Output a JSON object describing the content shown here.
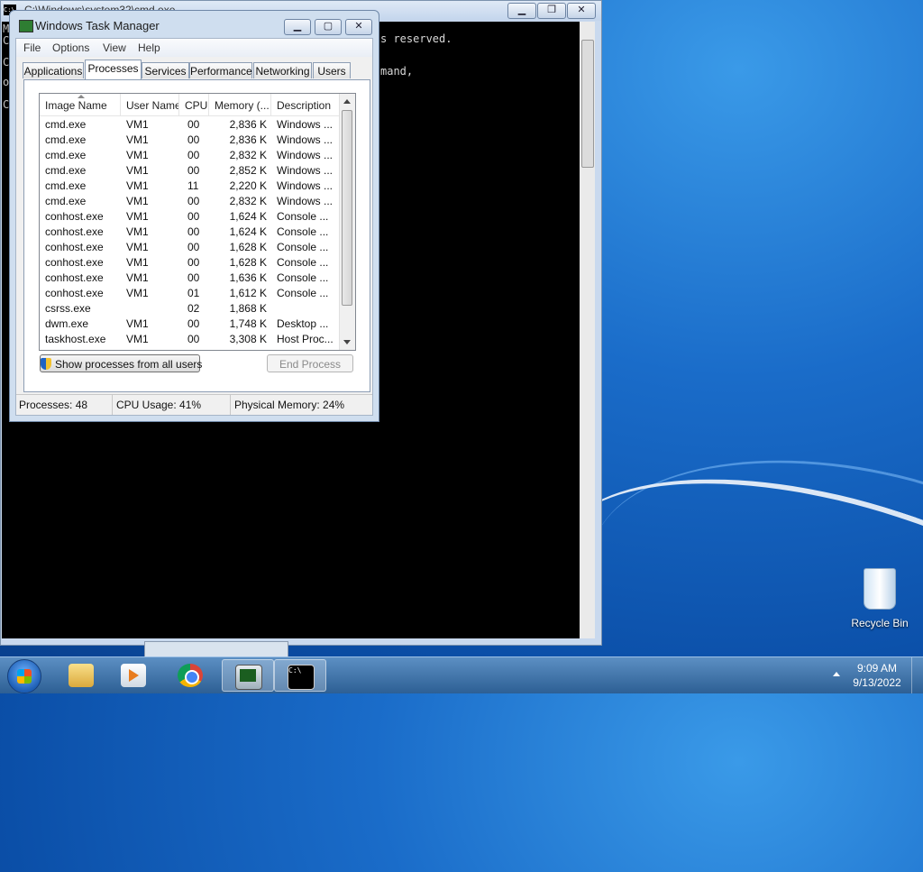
{
  "cmd": {
    "title": "C:\\Windows\\system32\\cmd.exe",
    "icon_label": "C:\\",
    "lines": [
      "M",
      "C",
      "",
      "C",
      "o",
      "",
      "C"
    ],
    "right_fragments": [
      "s reserved.",
      "",
      "mand,"
    ]
  },
  "taskmgr": {
    "title": "Windows Task Manager",
    "menu": [
      "File",
      "Options",
      "View",
      "Help"
    ],
    "tabs": [
      "Applications",
      "Processes",
      "Services",
      "Performance",
      "Networking",
      "Users"
    ],
    "active_tab": "Processes",
    "columns": [
      "Image Name",
      "User Name",
      "CPU",
      "Memory (...",
      "Description"
    ],
    "rows": [
      {
        "image": "cmd.exe",
        "user": "VM1",
        "cpu": "00",
        "mem": "2,836 K",
        "desc": "Windows ..."
      },
      {
        "image": "cmd.exe",
        "user": "VM1",
        "cpu": "00",
        "mem": "2,836 K",
        "desc": "Windows ..."
      },
      {
        "image": "cmd.exe",
        "user": "VM1",
        "cpu": "00",
        "mem": "2,832 K",
        "desc": "Windows ..."
      },
      {
        "image": "cmd.exe",
        "user": "VM1",
        "cpu": "00",
        "mem": "2,852 K",
        "desc": "Windows ..."
      },
      {
        "image": "cmd.exe",
        "user": "VM1",
        "cpu": "11",
        "mem": "2,220 K",
        "desc": "Windows ..."
      },
      {
        "image": "cmd.exe",
        "user": "VM1",
        "cpu": "00",
        "mem": "2,832 K",
        "desc": "Windows ..."
      },
      {
        "image": "conhost.exe",
        "user": "VM1",
        "cpu": "00",
        "mem": "1,624 K",
        "desc": "Console ..."
      },
      {
        "image": "conhost.exe",
        "user": "VM1",
        "cpu": "00",
        "mem": "1,624 K",
        "desc": "Console ..."
      },
      {
        "image": "conhost.exe",
        "user": "VM1",
        "cpu": "00",
        "mem": "1,628 K",
        "desc": "Console ..."
      },
      {
        "image": "conhost.exe",
        "user": "VM1",
        "cpu": "00",
        "mem": "1,628 K",
        "desc": "Console ..."
      },
      {
        "image": "conhost.exe",
        "user": "VM1",
        "cpu": "00",
        "mem": "1,636 K",
        "desc": "Console ..."
      },
      {
        "image": "conhost.exe",
        "user": "VM1",
        "cpu": "01",
        "mem": "1,612 K",
        "desc": "Console ..."
      },
      {
        "image": "csrss.exe",
        "user": "",
        "cpu": "02",
        "mem": "1,868 K",
        "desc": ""
      },
      {
        "image": "dwm.exe",
        "user": "VM1",
        "cpu": "00",
        "mem": "1,748 K",
        "desc": "Desktop ..."
      },
      {
        "image": "taskhost.exe",
        "user": "VM1",
        "cpu": "00",
        "mem": "3,308 K",
        "desc": "Host Proc..."
      }
    ],
    "show_all_label": "Show processes from all users",
    "end_process_label": "End Process",
    "status": {
      "processes": "Processes: 48",
      "cpu": "CPU Usage: 41%",
      "memory": "Physical Memory: 24%"
    }
  },
  "desktop": {
    "recycle_bin": "Recycle Bin"
  },
  "taskbar": {
    "time": "9:09 AM",
    "date": "9/13/2022"
  },
  "colors": {
    "desktop": "#1a6cc9",
    "window_frame": "#cfdeef",
    "taskbar": "#2d5f94"
  }
}
